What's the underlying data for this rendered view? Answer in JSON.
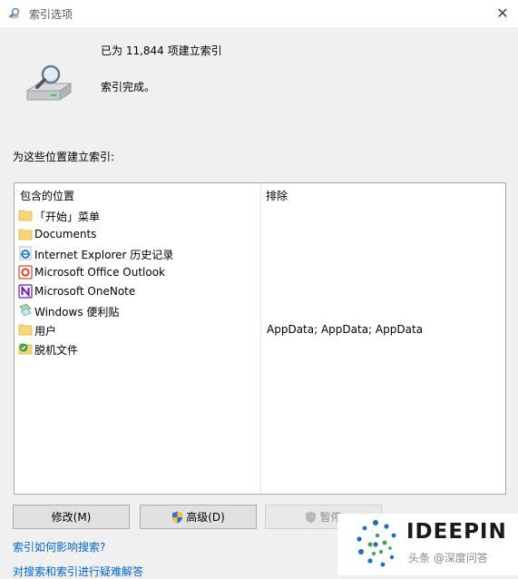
{
  "window": {
    "title": "索引选项"
  },
  "status": {
    "count_text": "已为 11,844 项建立索引",
    "done_text": "索引完成。"
  },
  "section_label": "为这些位置建立索引:",
  "list": {
    "headers": {
      "included": "包含的位置",
      "excluded": "排除"
    },
    "rows": [
      {
        "name": "「开始」菜单",
        "excluded": "",
        "icon": "folder-icon"
      },
      {
        "name": "Documents",
        "excluded": "",
        "icon": "folder-icon"
      },
      {
        "name": "Internet Explorer 历史记录",
        "excluded": "",
        "icon": "internet-explorer-icon"
      },
      {
        "name": "Microsoft Office Outlook",
        "excluded": "",
        "icon": "outlook-icon"
      },
      {
        "name": "Microsoft OneNote",
        "excluded": "",
        "icon": "onenote-icon"
      },
      {
        "name": "Windows 便利贴",
        "excluded": "",
        "icon": "sticky-notes-icon"
      },
      {
        "name": "用户",
        "excluded": "AppData; AppData; AppData",
        "icon": "folder-icon"
      },
      {
        "name": "脱机文件",
        "excluded": "",
        "icon": "offline-files-icon"
      }
    ]
  },
  "buttons": {
    "modify": "修改(M)",
    "advanced": "高级(D)",
    "pause": "暂停"
  },
  "links": {
    "how_affects": "索引如何影响搜索?",
    "troubleshoot": "对搜索和索引进行疑难解答"
  },
  "watermark": {
    "logo": "IDEEPIN",
    "sub": "头条 @深度问答"
  },
  "colors": {
    "link": "#0066cc",
    "folder": "#f7d774",
    "outlook": "#d24726",
    "onenote": "#7719aa"
  }
}
